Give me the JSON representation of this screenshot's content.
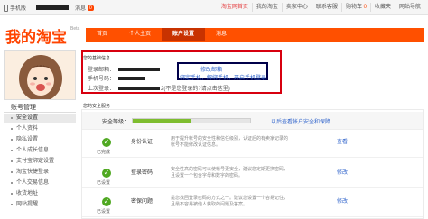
{
  "topbar": {
    "mobile_label": "手机版",
    "messages_label": "消息",
    "message_count": "0",
    "nav": [
      "淘宝网首页",
      "我的淘宝",
      "卖家中心",
      "联系客服",
      "购物车",
      "收藏夹",
      "网站导航"
    ],
    "cart_count": "0"
  },
  "logo": {
    "text": "我的淘宝",
    "beta": "Beta"
  },
  "navbar": {
    "items": [
      "首页",
      "个人主页",
      "账户设置",
      "消息"
    ],
    "active_index": 2
  },
  "sidebar": {
    "title": "账号管理",
    "items": [
      "安全设置",
      "个人资料",
      "隐私设置",
      "个人成长信息",
      "支付宝绑定设置",
      "淘宝快捷登录",
      "个人交易信息",
      "收货地址",
      "网站提醒"
    ],
    "active_index": 0
  },
  "account_info": {
    "heading": "您的基础信息",
    "email_label": "登录邮箱：",
    "phone_label": "手机号码：",
    "last_login_label": "上次登录：",
    "change_email_link": "修改邮箱",
    "bind_links": "绑定手机，解绑手机，开启手机登录",
    "login_note": "2(不是您登录的?请点击这里)"
  },
  "security": {
    "heading": "您的安全服务",
    "level_label": "安全等级：",
    "level_fraction": 0.5,
    "level_link": "以后查看帐户安全和保障",
    "services": [
      {
        "status": "已完成",
        "name": "身份认证",
        "desc": "用于提升帐号的安全性和信任级别，认证后的有卖家记录的帐号不能修改认证信息。",
        "action": "查看"
      },
      {
        "status": "已设置",
        "name": "登录密码",
        "desc": "安全性高的密码可以使帐号更安全，建议您定期更换密码，且设置一个包含字母和数字的密码。",
        "action": "修改"
      },
      {
        "status": "已设置",
        "name": "密保问题",
        "desc": "是您找回登录密码的方式之一。建议您设置一个容易记住，且最不容易被他人获取的问题及答案。",
        "action": "修改"
      }
    ]
  },
  "colors": {
    "brand": "#ff5000",
    "highlight_border": "#d7000f",
    "link": "#3366cc",
    "ok": "#4fa821"
  }
}
